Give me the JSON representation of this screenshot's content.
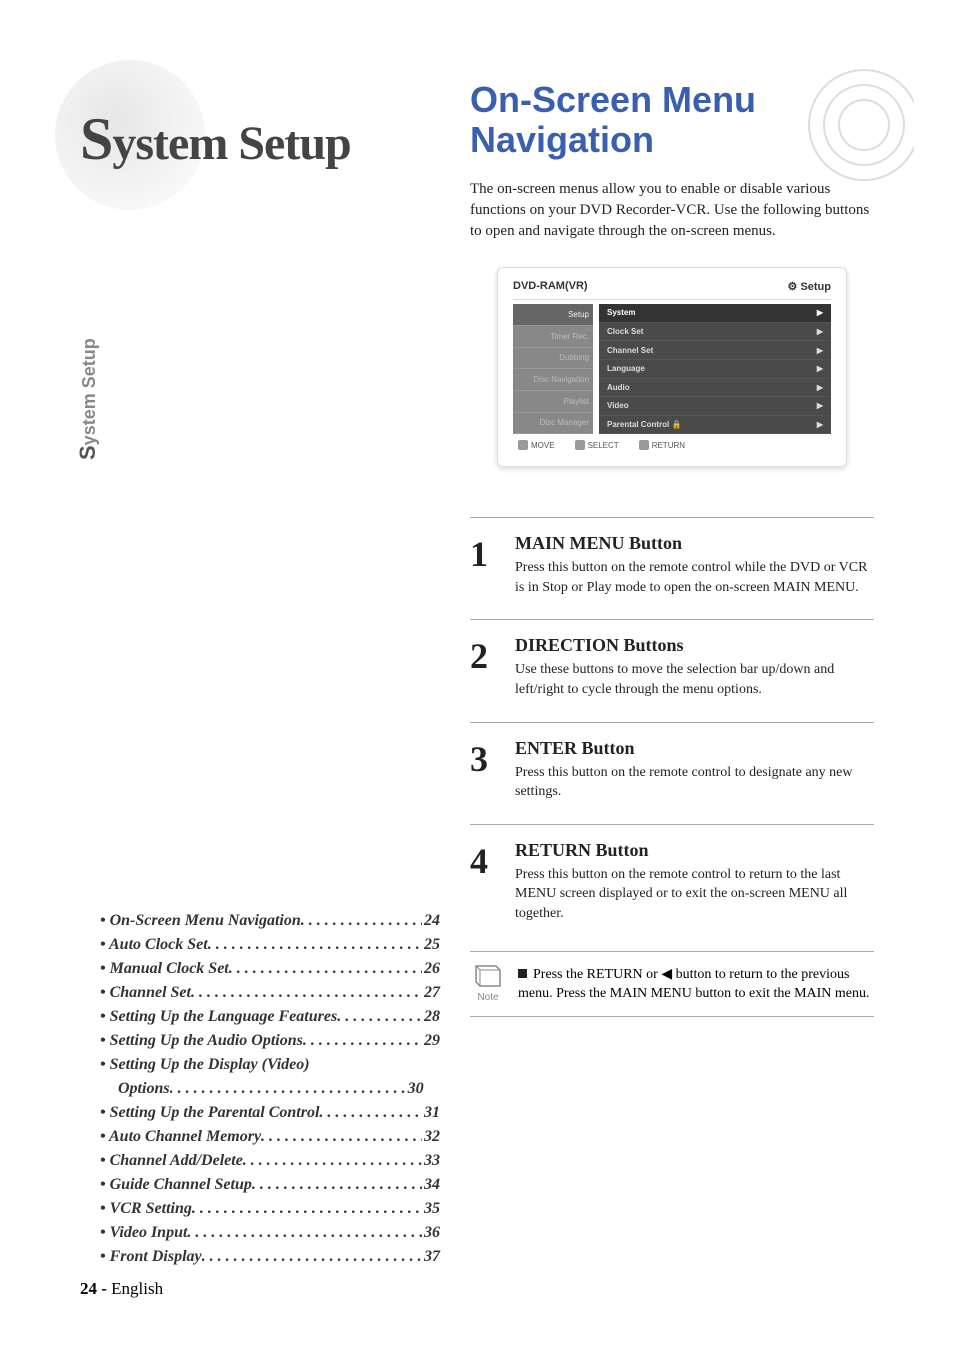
{
  "side_tab": {
    "first_letter": "S",
    "rest": "ystem Setup"
  },
  "main_title": {
    "first_letter": "S",
    "rest": "ystem Setup"
  },
  "section_title_line1": "On-Screen Menu",
  "section_title_line2": "Navigation",
  "intro_text": "The on-screen menus allow you to enable or disable various functions on your DVD Recorder-VCR. Use the following buttons to open and navigate through the on-screen menus.",
  "menu": {
    "header_left": "DVD-RAM(VR)",
    "header_right": "Setup",
    "left_items": [
      "Setup",
      "Timer Rec.",
      "Dubbing",
      "Disc Navigation",
      "Playlist",
      "Disc Manager"
    ],
    "right_items": [
      "System",
      "Clock Set",
      "Channel Set",
      "Language",
      "Audio",
      "Video",
      "Parental Control"
    ],
    "footer": [
      "MOVE",
      "SELECT",
      "RETURN"
    ]
  },
  "steps": [
    {
      "num": "1",
      "title": "MAIN MENU Button",
      "desc": "Press this button on the remote control while the DVD or VCR is in Stop or Play mode to open the on-screen MAIN MENU."
    },
    {
      "num": "2",
      "title": "DIRECTION Buttons",
      "desc": "Use these buttons to move the selection bar up/down and left/right to cycle through the menu options."
    },
    {
      "num": "3",
      "title": "ENTER Button",
      "desc": "Press this button on the remote control to designate any new settings."
    },
    {
      "num": "4",
      "title": "RETURN Button",
      "desc": "Press this button on the remote control to return to the last MENU screen displayed or to exit the on-screen MENU all together."
    }
  ],
  "note": {
    "label": "Note",
    "text_pre": "Press the RETURN or ",
    "text_post": " button to return to the previous menu. Press the MAIN MENU button to exit the MAIN menu."
  },
  "toc": [
    {
      "label": "On-Screen Menu Navigation",
      "page": "24"
    },
    {
      "label": "Auto Clock Set",
      "page": "25"
    },
    {
      "label": "Manual Clock Set",
      "page": "26"
    },
    {
      "label": "Channel Set",
      "page": "27"
    },
    {
      "label": "Setting Up the Language Features",
      "page": "28"
    },
    {
      "label": "Setting Up the Audio Options",
      "page": "29"
    },
    {
      "label": "Setting Up the Display (Video)",
      "page": ""
    },
    {
      "label": "Options",
      "page": "30",
      "indent": true
    },
    {
      "label": "Setting Up the Parental Control",
      "page": "31"
    },
    {
      "label": "Auto Channel Memory",
      "page": "32"
    },
    {
      "label": "Channel Add/Delete",
      "page": "33"
    },
    {
      "label": "Guide Channel Setup",
      "page": "34"
    },
    {
      "label": "VCR Setting",
      "page": "35"
    },
    {
      "label": "Video Input",
      "page": "36"
    },
    {
      "label": "Front Display",
      "page": "37"
    }
  ],
  "footer": {
    "page_num": "24 -",
    "lang": "English"
  }
}
